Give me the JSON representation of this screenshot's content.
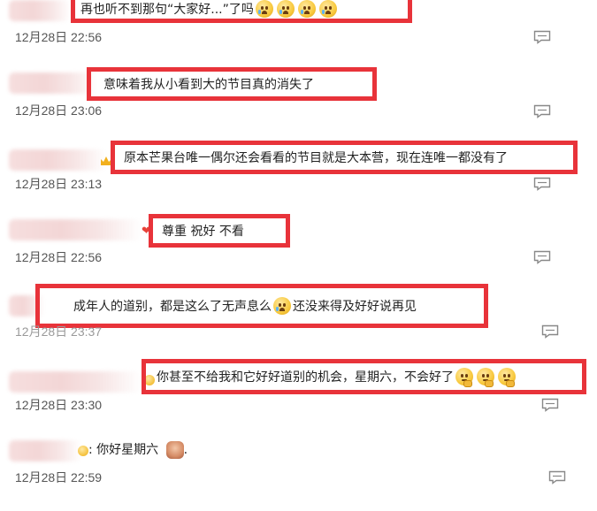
{
  "comments": [
    {
      "text": "再也听不到那句“大家好...”了吗",
      "emojis": [
        "cry",
        "cry",
        "cry",
        "cry"
      ],
      "time": "12月28日 22:56"
    },
    {
      "text": "意味着我从小看到大的节目真的消失了",
      "emojis": [],
      "time": "12月28日 23:06"
    },
    {
      "text": "原本芒果台唯一偶尔还会看看的节目就是大本营，现在连唯一都没有了",
      "emojis": [],
      "time": "12月28日 23:13"
    },
    {
      "text": "尊重 祝好 不看",
      "emojis": [],
      "time": "12月28日 22:56"
    },
    {
      "text_before": "成年人的道别，都是这么了无声息么",
      "text_after": "还没来得及好好说再见",
      "emojis": [
        "cry"
      ],
      "time": "12月28日 23:37"
    },
    {
      "text": "你甚至不给我和它好好道别的机会，星期六，不会好了",
      "emojis": [
        "think",
        "think",
        "think"
      ],
      "time": "12月28日 23:30"
    },
    {
      "text": "你好星期六",
      "emojis": [],
      "time": "12月28日 22:59"
    }
  ],
  "colors": {
    "highlight_border": "#e8333a",
    "timestamp": "#555555"
  },
  "icons": {
    "reply": "comment-icon",
    "emoji_cry": "crying-face-icon",
    "emoji_think": "thinking-face-icon"
  }
}
